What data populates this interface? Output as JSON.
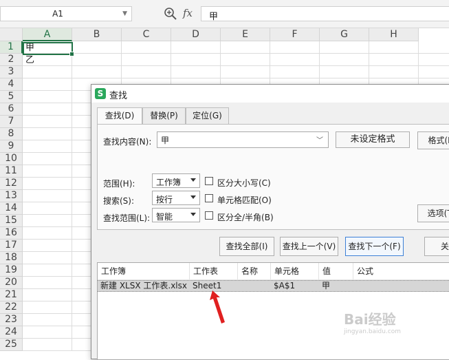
{
  "formula_bar": {
    "name_box": "A1",
    "fx_label": "fx",
    "formula": "甲"
  },
  "grid": {
    "columns": [
      "A",
      "B",
      "C",
      "D",
      "E",
      "F",
      "G",
      "H"
    ],
    "rows": [
      "1",
      "2",
      "3",
      "4",
      "5",
      "6",
      "7",
      "8",
      "9",
      "10",
      "11",
      "12",
      "13",
      "14",
      "15",
      "16",
      "17",
      "18",
      "19",
      "20",
      "21",
      "22",
      "23",
      "24",
      "25"
    ],
    "cells": {
      "A1": "甲",
      "A2": "乙"
    }
  },
  "dialog": {
    "title": "查找",
    "tabs": [
      {
        "label": "查找(D)"
      },
      {
        "label": "替换(P)"
      },
      {
        "label": "定位(G)"
      }
    ],
    "find_label": "查找内容(N):",
    "find_value": "甲",
    "no_format_button": "未设定格式",
    "format_button": "格式(M",
    "scope_label": "范围(H):",
    "scope_value": "工作簿",
    "search_label": "搜索(S):",
    "search_value": "按行",
    "lookin_label": "查找范围(L):",
    "lookin_value": "智能",
    "match_case": "区分大小写(C)",
    "match_cell": "单元格匹配(O)",
    "match_width": "区分全/半角(B)",
    "options_button": "选项(T)",
    "find_all_button": "查找全部(I)",
    "find_prev_button": "查找上一个(V)",
    "find_next_button": "查找下一个(F)",
    "close_button": "关",
    "results": {
      "headers": [
        "工作簿",
        "工作表",
        "名称",
        "单元格",
        "值",
        "公式"
      ],
      "row": {
        "workbook": "新建 XLSX 工作表.xlsx",
        "sheet": "Sheet1",
        "name": "",
        "cell": "$A$1",
        "value": "甲",
        "formula": ""
      }
    }
  },
  "watermark": {
    "main": "Bai经验",
    "sub": "jingyan.baidu.com"
  },
  "colors": {
    "accent_green": "#217346",
    "arrow_red": "#e02020",
    "primary_blue": "#3b7fd6"
  }
}
